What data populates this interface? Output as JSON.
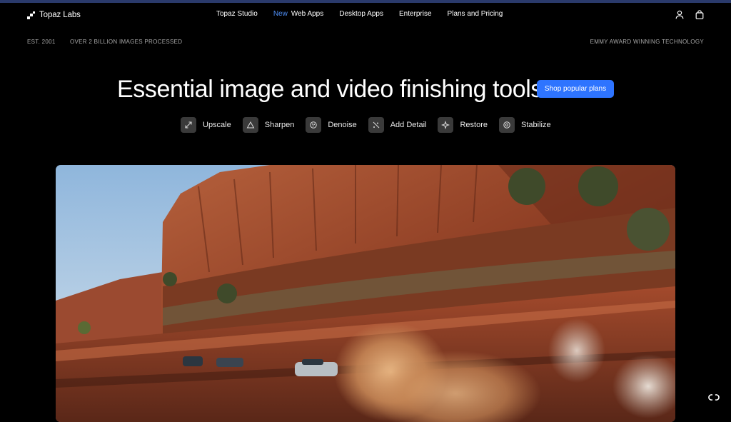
{
  "brand": {
    "name": "Topaz Labs"
  },
  "nav": {
    "items": [
      {
        "label": "Topaz Studio"
      },
      {
        "badge": "New",
        "label": "Web Apps"
      },
      {
        "label": "Desktop Apps"
      },
      {
        "label": "Enterprise"
      },
      {
        "label": "Plans and Pricing"
      }
    ],
    "icons": [
      "user-icon",
      "shopping-bag-icon"
    ]
  },
  "meta": {
    "est": "EST. 2001",
    "processed": "OVER 2 BILLION IMAGES PROCESSED",
    "award": "EMMY AWARD WINNING TECHNOLOGY"
  },
  "hero": {
    "title": "Essential image and video finishing tools.",
    "cta": "Shop popular plans"
  },
  "features": [
    {
      "label": "Upscale",
      "icon": "expand-arrows-icon"
    },
    {
      "label": "Sharpen",
      "icon": "triangle-icon"
    },
    {
      "label": "Denoise",
      "icon": "grain-circle-icon"
    },
    {
      "label": "Add Detail",
      "icon": "sparkles-icon"
    },
    {
      "label": "Restore",
      "icon": "star-icon"
    },
    {
      "label": "Stabilize",
      "icon": "target-icon"
    }
  ],
  "colors": {
    "accent": "#2e74ff",
    "new_badge": "#4f8ff7",
    "background": "#000000"
  }
}
